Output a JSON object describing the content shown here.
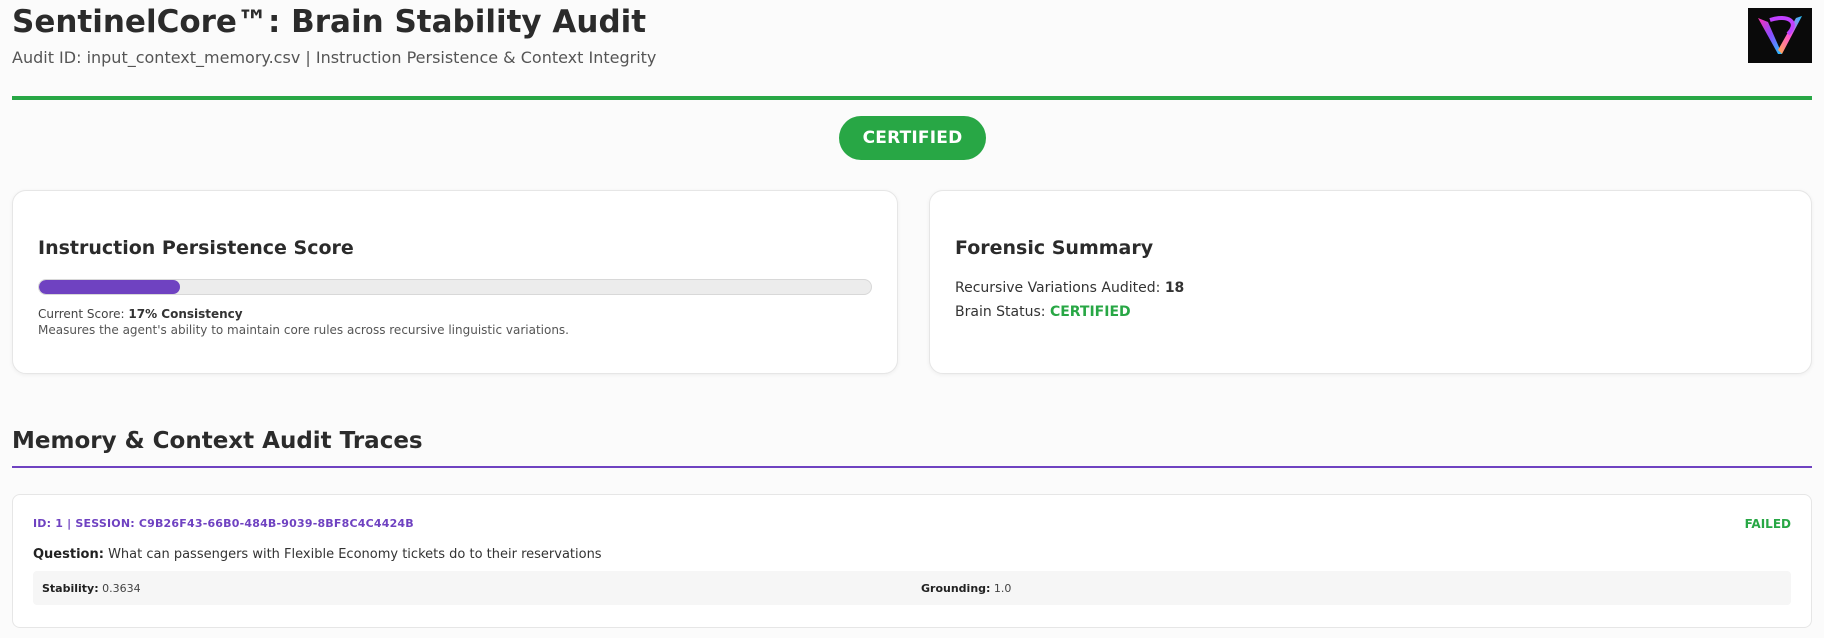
{
  "header": {
    "title": "SentinelCore™: Brain Stability Audit",
    "subtitle": "Audit ID: input_context_memory.csv | Instruction Persistence & Context Integrity",
    "logo_icon": "v-gradient-logo-icon"
  },
  "status_badge": {
    "label": "CERTIFIED",
    "color": "#28a745"
  },
  "persistence_card": {
    "title": "Instruction Persistence Score",
    "progress_fraction": 0.17,
    "score_label": "Current Score:",
    "score_value": "17% Consistency",
    "description": "Measures the agent's ability to maintain core rules across recursive linguistic variations.",
    "bar_color": "#6f42c1"
  },
  "forensic_card": {
    "title": "Forensic Summary",
    "variations_label": "Recursive Variations Audited:",
    "variations_value": "18",
    "brain_status_label": "Brain Status:",
    "brain_status_value": "CERTIFIED"
  },
  "traces_section": {
    "title": "Memory & Context Audit Traces",
    "traces": [
      {
        "id_line": "ID: 1 | SESSION: C9B26F43-66B0-484B-9039-8BF8C4C4424B",
        "status": "FAILED",
        "question_label": "Question:",
        "question_text": "What can passengers with Flexible Economy tickets do to their reservations",
        "stability_label": "Stability:",
        "stability_value": "0.3634",
        "grounding_label": "Grounding:",
        "grounding_value": "1.0"
      }
    ]
  },
  "colors": {
    "accent_green": "#28a745",
    "accent_purple": "#6f42c1"
  }
}
